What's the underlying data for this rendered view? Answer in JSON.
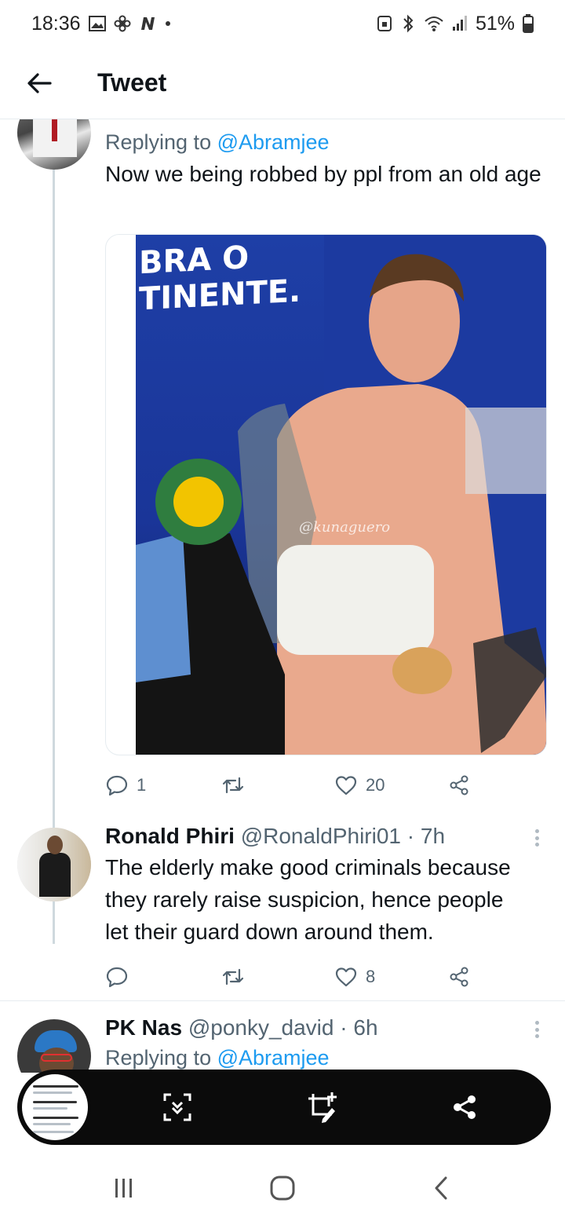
{
  "status_bar": {
    "time": "18:36",
    "battery": "51%",
    "icons": [
      "image-icon",
      "fan-icon",
      "n-app-icon",
      "dot-icon",
      "lock-icon",
      "bluetooth-icon",
      "wifi-icon",
      "signal-icon",
      "battery-icon"
    ]
  },
  "header": {
    "title": "Tweet",
    "back_icon": "arrow-left-icon"
  },
  "tweets": [
    {
      "replying_prefix": "Replying to",
      "replying_handle": "@Abramjee",
      "text": "Now we being robbed by ppl from an old age",
      "media": {
        "overlay_line1": "BRA O",
        "overlay_line2": "TINENTE.",
        "watermark": "@kunaguero"
      },
      "actions": {
        "replies": "1",
        "retweets": "",
        "likes": "20"
      }
    },
    {
      "name": "Ronald Phiri",
      "handle": "@RonaldPhiri01",
      "time": "· 7h",
      "text": "The elderly make good criminals because they rarely raise suspicion, hence people let their guard down around them.",
      "actions": {
        "replies": "",
        "retweets": "",
        "likes": "8"
      }
    },
    {
      "name": "PK Nas",
      "handle": "@ponky_david",
      "time": "· 6h",
      "replying_prefix": "Replying to",
      "replying_handle": "@Abramjee"
    }
  ],
  "screenshot_toolbar": {
    "buttons": [
      "scroll-capture-icon",
      "crop-edit-icon",
      "share-icon"
    ]
  },
  "nav_bar": {
    "buttons": [
      "recents-icon",
      "home-icon",
      "back-icon"
    ]
  },
  "colors": {
    "accent": "#1d9bf0",
    "secondary_text": "#536471",
    "primary_text": "#0f1419",
    "divider": "#e6ecf0"
  }
}
